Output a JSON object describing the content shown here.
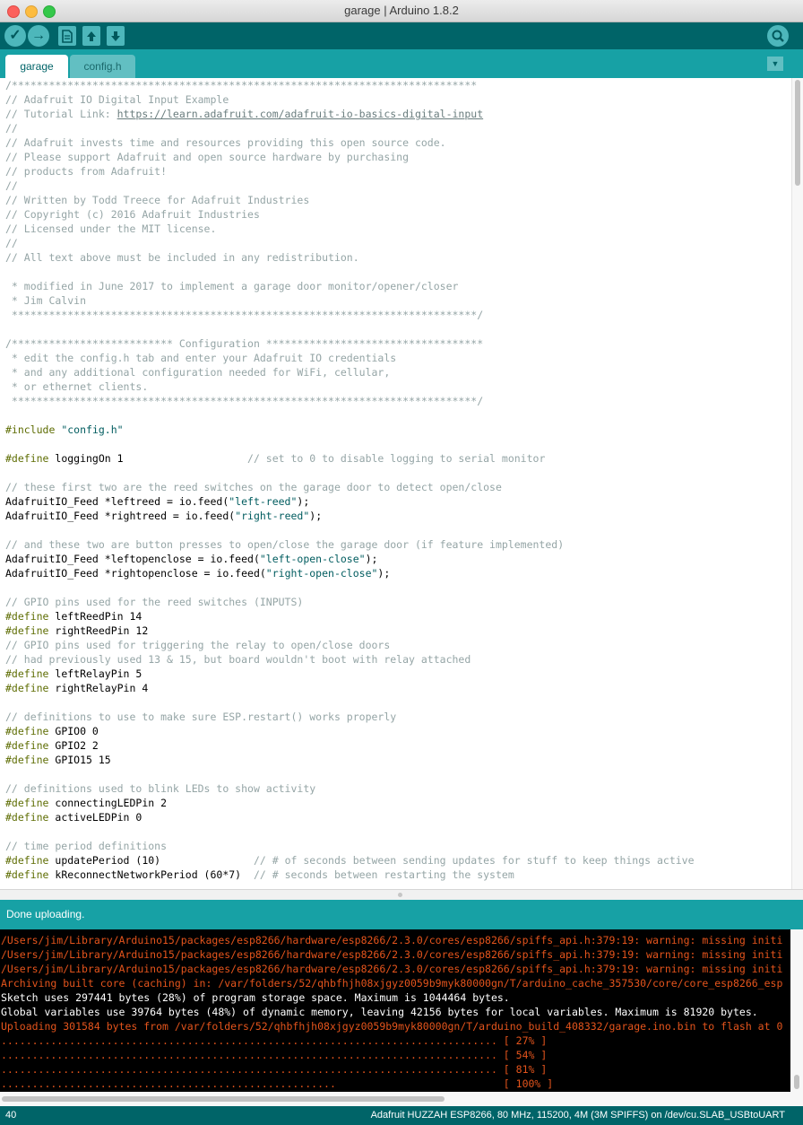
{
  "window": {
    "title": "garage | Arduino 1.8.2"
  },
  "colors": {
    "toolbar": "#006468",
    "tabbar": "#17a1a5",
    "console_bg": "#000000",
    "console_error": "#e4541c",
    "comment": "#95a5a6",
    "keyword": "#5e6d03",
    "string": "#005c5f"
  },
  "toolbar": {
    "icons": [
      "verify-icon",
      "upload-icon",
      "new-icon",
      "open-icon",
      "save-icon",
      "serial-monitor-icon"
    ],
    "verify_glyph": "✓",
    "upload_glyph": "→"
  },
  "tabs": [
    {
      "label": "garage",
      "active": true
    },
    {
      "label": "config.h",
      "active": false
    }
  ],
  "tab_menu_glyph": "▼",
  "editor": {
    "lines": [
      [
        [
          "c",
          "/***************************************************************************"
        ]
      ],
      [
        [
          "c",
          "// Adafruit IO Digital Input Example"
        ]
      ],
      [
        [
          "c",
          "// Tutorial Link: "
        ],
        [
          "u",
          "https://learn.adafruit.com/adafruit-io-basics-digital-input"
        ]
      ],
      [
        [
          "c",
          "//"
        ]
      ],
      [
        [
          "c",
          "// Adafruit invests time and resources providing this open source code."
        ]
      ],
      [
        [
          "c",
          "// Please support Adafruit and open source hardware by purchasing"
        ]
      ],
      [
        [
          "c",
          "// products from Adafruit!"
        ]
      ],
      [
        [
          "c",
          "//"
        ]
      ],
      [
        [
          "c",
          "// Written by Todd Treece for Adafruit Industries"
        ]
      ],
      [
        [
          "c",
          "// Copyright (c) 2016 Adafruit Industries"
        ]
      ],
      [
        [
          "c",
          "// Licensed under the MIT license."
        ]
      ],
      [
        [
          "c",
          "//"
        ]
      ],
      [
        [
          "c",
          "// All text above must be included in any redistribution."
        ]
      ],
      [],
      [
        [
          "c",
          " * modified in June 2017 to implement a garage door monitor/opener/closer"
        ]
      ],
      [
        [
          "c",
          " * Jim Calvin"
        ]
      ],
      [
        [
          "c",
          " ***************************************************************************/"
        ]
      ],
      [],
      [
        [
          "c",
          "/************************** Configuration ***********************************"
        ]
      ],
      [
        [
          "c",
          " * edit the config.h tab and enter your Adafruit IO credentials"
        ]
      ],
      [
        [
          "c",
          " * and any additional configuration needed for WiFi, cellular,"
        ]
      ],
      [
        [
          "c",
          " * or ethernet clients."
        ]
      ],
      [
        [
          "c",
          " ***************************************************************************/"
        ]
      ],
      [],
      [
        [
          "k",
          "#include"
        ],
        [
          "t",
          " "
        ],
        [
          "s",
          "\"config.h\""
        ]
      ],
      [],
      [
        [
          "k",
          "#define"
        ],
        [
          "t",
          " loggingOn 1                    "
        ],
        [
          "c",
          "// set to 0 to disable logging to serial monitor"
        ]
      ],
      [],
      [
        [
          "c",
          "// these first two are the reed switches on the garage door to detect open/close"
        ]
      ],
      [
        [
          "t",
          "AdafruitIO_Feed *leftreed = io.feed("
        ],
        [
          "s",
          "\"left-reed\""
        ],
        [
          "t",
          ");"
        ]
      ],
      [
        [
          "t",
          "AdafruitIO_Feed *rightreed = io.feed("
        ],
        [
          "s",
          "\"right-reed\""
        ],
        [
          "t",
          ");"
        ]
      ],
      [],
      [
        [
          "c",
          "// and these two are button presses to open/close the garage door (if feature implemented)"
        ]
      ],
      [
        [
          "t",
          "AdafruitIO_Feed *leftopenclose = io.feed("
        ],
        [
          "s",
          "\"left-open-close\""
        ],
        [
          "t",
          ");"
        ]
      ],
      [
        [
          "t",
          "AdafruitIO_Feed *rightopenclose = io.feed("
        ],
        [
          "s",
          "\"right-open-close\""
        ],
        [
          "t",
          ");"
        ]
      ],
      [],
      [
        [
          "c",
          "// GPIO pins used for the reed switches (INPUTS)"
        ]
      ],
      [
        [
          "k",
          "#define"
        ],
        [
          "t",
          " leftReedPin 14"
        ]
      ],
      [
        [
          "k",
          "#define"
        ],
        [
          "t",
          " rightReedPin 12"
        ]
      ],
      [
        [
          "c",
          "// GPIO pins used for triggering the relay to open/close doors"
        ]
      ],
      [
        [
          "c",
          "// had previously used 13 & 15, but board wouldn't boot with relay attached"
        ]
      ],
      [
        [
          "k",
          "#define"
        ],
        [
          "t",
          " leftRelayPin 5"
        ]
      ],
      [
        [
          "k",
          "#define"
        ],
        [
          "t",
          " rightRelayPin 4"
        ]
      ],
      [],
      [
        [
          "c",
          "// definitions to use to make sure ESP.restart() works properly"
        ]
      ],
      [
        [
          "k",
          "#define"
        ],
        [
          "t",
          " GPIO0 0"
        ]
      ],
      [
        [
          "k",
          "#define"
        ],
        [
          "t",
          " GPIO2 2"
        ]
      ],
      [
        [
          "k",
          "#define"
        ],
        [
          "t",
          " GPIO15 15"
        ]
      ],
      [],
      [
        [
          "c",
          "// definitions used to blink LEDs to show activity"
        ]
      ],
      [
        [
          "k",
          "#define"
        ],
        [
          "t",
          " connectingLEDPin 2"
        ]
      ],
      [
        [
          "k",
          "#define"
        ],
        [
          "t",
          " activeLEDPin 0"
        ]
      ],
      [],
      [
        [
          "c",
          "// time period definitions"
        ]
      ],
      [
        [
          "k",
          "#define"
        ],
        [
          "t",
          " updatePeriod (10)               "
        ],
        [
          "c",
          "// # of seconds between sending updates for stuff to keep things active"
        ]
      ],
      [
        [
          "k",
          "#define"
        ],
        [
          "t",
          " kReconnectNetworkPeriod (60*7)  "
        ],
        [
          "c",
          "// # seconds between restarting the system"
        ]
      ]
    ]
  },
  "status": {
    "message": "Done uploading."
  },
  "console": {
    "lines": [
      [
        "e",
        "/Users/jim/Library/Arduino15/packages/esp8266/hardware/esp8266/2.3.0/cores/esp8266/spiffs_api.h:379:19: warning: missing initi"
      ],
      [
        "e",
        "/Users/jim/Library/Arduino15/packages/esp8266/hardware/esp8266/2.3.0/cores/esp8266/spiffs_api.h:379:19: warning: missing initi"
      ],
      [
        "e",
        "/Users/jim/Library/Arduino15/packages/esp8266/hardware/esp8266/2.3.0/cores/esp8266/spiffs_api.h:379:19: warning: missing initi"
      ],
      [
        "e",
        "Archiving built core (caching) in: /var/folders/52/qhbfhjh08xjgyz0059b9myk80000gn/T/arduino_cache_357530/core/core_esp8266_esp"
      ],
      [
        "i",
        "Sketch uses 297441 bytes (28%) of program storage space. Maximum is 1044464 bytes."
      ],
      [
        "i",
        "Global variables use 39764 bytes (48%) of dynamic memory, leaving 42156 bytes for local variables. Maximum is 81920 bytes."
      ],
      [
        "e",
        "Uploading 301584 bytes from /var/folders/52/qhbfhjh08xjgyz0059b9myk80000gn/T/arduino_build_408332/garage.ino.bin to flash at 0"
      ],
      [
        "e",
        "................................................................................ [ 27% ]"
      ],
      [
        "e",
        "................................................................................ [ 54% ]"
      ],
      [
        "e",
        "................................................................................ [ 81% ]"
      ],
      [
        "e",
        "......................................................                           [ 100% ]"
      ]
    ]
  },
  "footer": {
    "line_number": "40",
    "board": "Adafruit HUZZAH ESP8266, 80 MHz, 115200, 4M (3M SPIFFS) on /dev/cu.SLAB_USBtoUART"
  }
}
